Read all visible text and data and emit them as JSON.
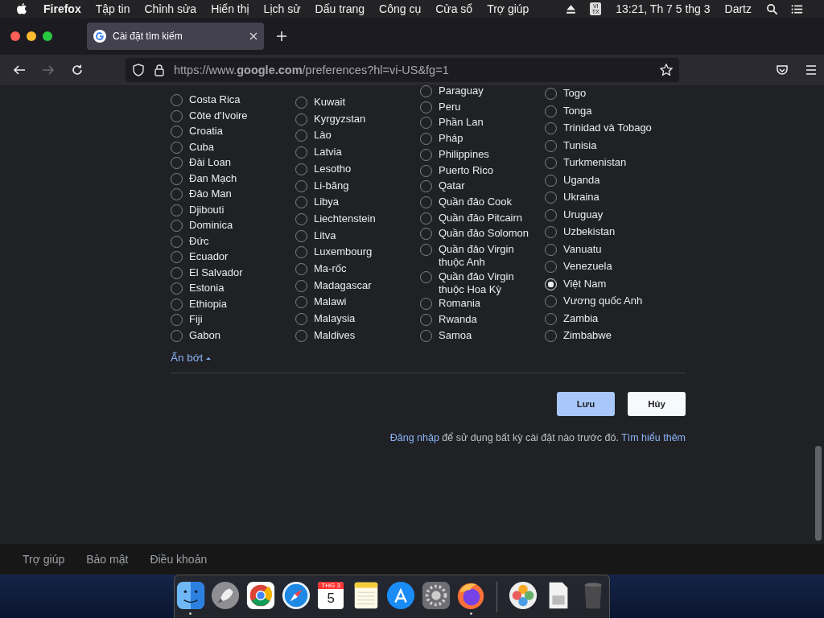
{
  "menu_bar": {
    "items": [
      {
        "label": "Firefox",
        "kind": "app"
      },
      {
        "label": "Tập tin",
        "kind": "menu"
      },
      {
        "label": "Chỉnh sửa",
        "kind": "menu"
      },
      {
        "label": "Hiển thị",
        "kind": "menu"
      },
      {
        "label": "Lịch sử",
        "kind": "menu"
      },
      {
        "label": "Dấu trang",
        "kind": "menu"
      },
      {
        "label": "Công cụ",
        "kind": "menu"
      },
      {
        "label": "Cửa sổ",
        "kind": "menu"
      },
      {
        "label": "Trợ giúp",
        "kind": "menu"
      }
    ],
    "input_method": "VI TX",
    "clock": "13:21, Th 7 5 thg 3",
    "user": "Dartz"
  },
  "tab": {
    "title": "Cài đặt tìm kiếm"
  },
  "toolbar": {
    "url": "https://www.**google.com**/preferences?hl=vi-US&fg=1",
    "forward_disabled": true
  },
  "regions": {
    "columns": [
      [
        {
          "name": "Costa Rica",
          "selected": false
        },
        {
          "name": "Côte d'Ivoire",
          "selected": false
        },
        {
          "name": "Croatia",
          "selected": false
        },
        {
          "name": "Cuba",
          "selected": false
        },
        {
          "name": "Đài Loan",
          "selected": false
        },
        {
          "name": "Đan Mạch",
          "selected": false
        },
        {
          "name": "Đảo Man",
          "selected": false
        },
        {
          "name": "Djibouti",
          "selected": false
        },
        {
          "name": "Dominica",
          "selected": false
        },
        {
          "name": "Đức",
          "selected": false
        },
        {
          "name": "Ecuador",
          "selected": false
        },
        {
          "name": "El Salvador",
          "selected": false
        },
        {
          "name": "Estonia",
          "selected": false
        },
        {
          "name": "Ethiopia",
          "selected": false
        },
        {
          "name": "Fiji",
          "selected": false
        },
        {
          "name": "Gabon",
          "selected": false
        }
      ],
      [
        {
          "name": "Kuwait",
          "selected": false
        },
        {
          "name": "Kyrgyzstan",
          "selected": false
        },
        {
          "name": "Lào",
          "selected": false
        },
        {
          "name": "Latvia",
          "selected": false
        },
        {
          "name": "Lesotho",
          "selected": false
        },
        {
          "name": "Li-băng",
          "selected": false
        },
        {
          "name": "Libya",
          "selected": false
        },
        {
          "name": "Liechtenstein",
          "selected": false
        },
        {
          "name": "Litva",
          "selected": false
        },
        {
          "name": "Luxembourg",
          "selected": false
        },
        {
          "name": "Ma-rốc",
          "selected": false
        },
        {
          "name": "Madagascar",
          "selected": false
        },
        {
          "name": "Malawi",
          "selected": false
        },
        {
          "name": "Malaysia",
          "selected": false
        },
        {
          "name": "Maldives",
          "selected": false
        }
      ],
      [
        {
          "name": "Paraguay",
          "selected": false
        },
        {
          "name": "Peru",
          "selected": false
        },
        {
          "name": "Phần Lan",
          "selected": false
        },
        {
          "name": "Pháp",
          "selected": false
        },
        {
          "name": "Philippines",
          "selected": false
        },
        {
          "name": "Puerto Rico",
          "selected": false
        },
        {
          "name": "Qatar",
          "selected": false
        },
        {
          "name": "Quần đảo Cook",
          "selected": false
        },
        {
          "name": "Quần đảo Pitcairn",
          "selected": false
        },
        {
          "name": "Quần đảo Solomon",
          "selected": false
        },
        {
          "name": "Quần đảo Virgin thuộc Anh",
          "selected": false
        },
        {
          "name": "Quần đảo Virgin thuộc Hoa Kỳ",
          "selected": false
        },
        {
          "name": "Romania",
          "selected": false
        },
        {
          "name": "Rwanda",
          "selected": false
        },
        {
          "name": "Samoa",
          "selected": false
        }
      ],
      [
        {
          "name": "Togo",
          "selected": false
        },
        {
          "name": "Tonga",
          "selected": false
        },
        {
          "name": "Trinidad và Tobago",
          "selected": false
        },
        {
          "name": "Tunisia",
          "selected": false
        },
        {
          "name": "Turkmenistan",
          "selected": false
        },
        {
          "name": "Uganda",
          "selected": false
        },
        {
          "name": "Ukraina",
          "selected": false
        },
        {
          "name": "Uruguay",
          "selected": false
        },
        {
          "name": "Uzbekistan",
          "selected": false
        },
        {
          "name": "Vanuatu",
          "selected": false
        },
        {
          "name": "Venezuela",
          "selected": false
        },
        {
          "name": "Việt Nam",
          "selected": true
        },
        {
          "name": "Vương quốc Anh",
          "selected": false
        },
        {
          "name": "Zambia",
          "selected": false
        },
        {
          "name": "Zimbabwe",
          "selected": false
        }
      ]
    ],
    "show_less": "Ẩn bớt"
  },
  "buttons": {
    "save": "Lưu",
    "cancel": "Hủy"
  },
  "notice": {
    "signin_link": "Đăng nhập",
    "text": "để sử dụng bất kỳ cài đặt nào trước đó.",
    "learn_more_link": "Tìm hiểu thêm"
  },
  "footer": {
    "links": [
      "Trợ giúp",
      "Bảo mật",
      "Điều khoản"
    ]
  },
  "dock": {
    "items": [
      {
        "kind": "finder",
        "running": true
      },
      {
        "kind": "rocket",
        "running": false
      },
      {
        "kind": "chrome",
        "running": false
      },
      {
        "kind": "compass",
        "running": false
      },
      {
        "kind": "calendar",
        "running": false,
        "month": "THG 3",
        "day": "5"
      },
      {
        "kind": "notes",
        "running": false
      },
      {
        "kind": "store",
        "running": false
      },
      {
        "kind": "gear",
        "running": false
      },
      {
        "kind": "fox",
        "running": true
      },
      {
        "kind": "divider"
      },
      {
        "kind": "photos",
        "running": false
      },
      {
        "kind": "document",
        "running": false
      },
      {
        "kind": "trash",
        "running": false
      }
    ]
  }
}
